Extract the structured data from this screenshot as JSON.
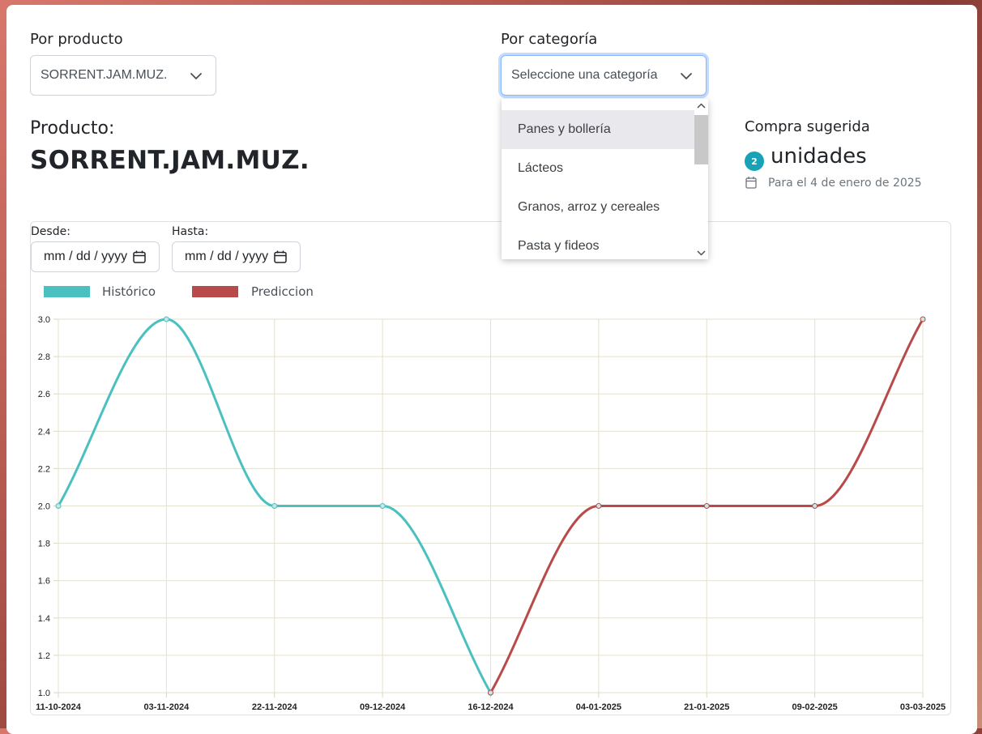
{
  "filters": {
    "product": {
      "label": "Por producto",
      "value": "SORRENT.JAM.MUZ."
    },
    "category": {
      "label": "Por categoría",
      "placeholder": "Seleccione una categoría",
      "options": [
        "Panes y bollería",
        "Lácteos",
        "Granos, arroz y cereales",
        "Pasta y fideos"
      ]
    }
  },
  "product": {
    "label": "Producto:",
    "name": "SORRENT.JAM.MUZ."
  },
  "suggestion": {
    "title": "Compra sugerida",
    "quantity": "2",
    "unit": "unidades",
    "date_note": "Para el 4 de enero de 2025"
  },
  "date_range": {
    "from_label": "Desde:",
    "to_label": "Hasta:",
    "from_placeholder": "mm / dd / yyyy",
    "to_placeholder": "mm / dd / yyyy"
  },
  "colors": {
    "historico": "#4bc0c0",
    "prediccion": "#b94a4a",
    "accent": "#17a2b8"
  },
  "chart_data": {
    "type": "line",
    "title": "",
    "xlabel": "",
    "ylabel": "",
    "categories": [
      "11-10-2024",
      "03-11-2024",
      "22-11-2024",
      "09-12-2024",
      "16-12-2024",
      "04-01-2025",
      "21-01-2025",
      "09-02-2025",
      "03-03-2025"
    ],
    "series": [
      {
        "name": "Histórico",
        "values": [
          2,
          3,
          2,
          2,
          1,
          null,
          null,
          null,
          null
        ],
        "color": "#4bc0c0"
      },
      {
        "name": "Prediccion",
        "values": [
          null,
          null,
          null,
          null,
          1,
          2,
          2,
          2,
          3
        ],
        "color": "#b94a4a"
      }
    ],
    "ylim": [
      1.0,
      3.0
    ],
    "yticks": [
      "1.0",
      "1.2",
      "1.4",
      "1.6",
      "1.8",
      "2.0",
      "2.2",
      "2.4",
      "2.6",
      "2.8",
      "3.0"
    ],
    "grid": true,
    "legend": "top-left"
  }
}
